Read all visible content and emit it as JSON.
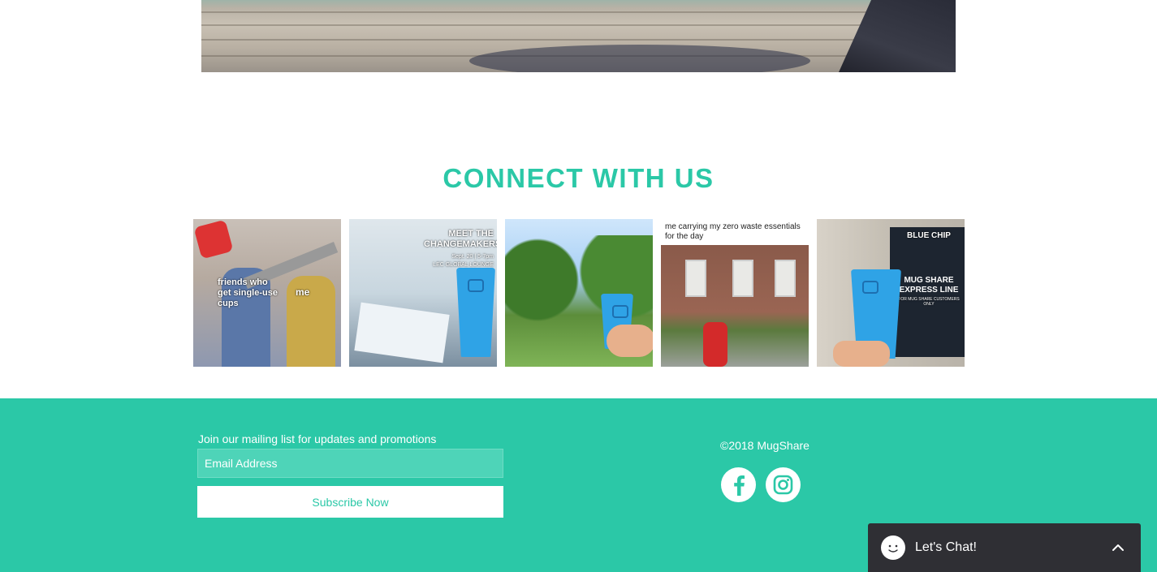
{
  "connect": {
    "title": "CONNECT WITH US",
    "posts": [
      {
        "overlay_text_1": "friends who get single-use cups",
        "overlay_text_2": "me"
      },
      {
        "overlay_text_1": "MEET THE CHANGEMAKERS",
        "overlay_text_2": "Sept. 20 | 5-7pm",
        "overlay_text_3": "LEC GLOBAL LOUNGE"
      },
      {},
      {
        "caption": "me carrying my zero waste essentials for the day"
      },
      {
        "overlay_text_1": "BLUE CHIP",
        "overlay_text_2": "MUG SHARE EXPRESS LINE",
        "overlay_text_3": "FOR MUG SHARE CUSTOMERS ONLY"
      }
    ]
  },
  "footer": {
    "mailing_label": "Join our mailing list for updates and promotions",
    "email_placeholder": "Email Address",
    "subscribe_label": "Subscribe Now",
    "copyright": "©2018 MugShare",
    "social": [
      "facebook-icon",
      "instagram-icon"
    ]
  },
  "chat": {
    "label": "Let's Chat!"
  },
  "colors": {
    "accent": "#2bc8a7",
    "chat_bg": "#2f2f34"
  }
}
